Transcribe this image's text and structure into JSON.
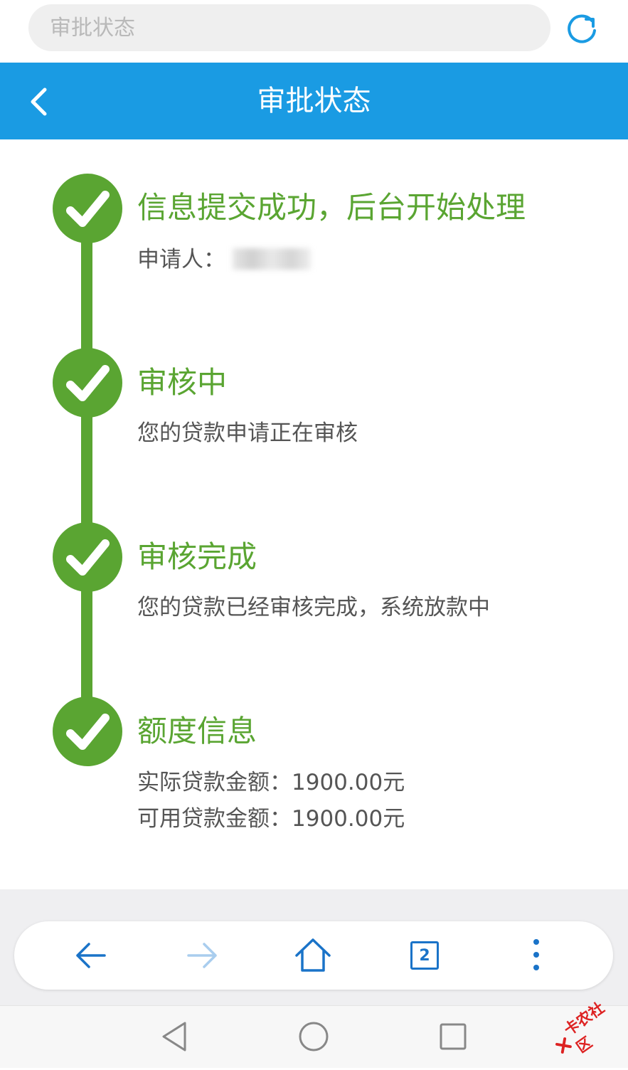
{
  "address_bar": {
    "placeholder": "审批状态"
  },
  "header": {
    "title": "审批状态"
  },
  "steps": [
    {
      "title": "信息提交成功，后台开始处理",
      "desc": "申请人："
    },
    {
      "title": "审核中",
      "desc": "您的贷款申请正在审核"
    },
    {
      "title": "审核完成",
      "desc": "您的贷款已经审核完成，系统放款中"
    },
    {
      "title": "额度信息",
      "desc": "实际贷款金额：1900.00元",
      "desc2": "可用贷款金额：1900.00元"
    }
  ],
  "browser_nav": {
    "tab_count": "2"
  },
  "watermark": {
    "text": "卡农社区"
  },
  "colors": {
    "primary": "#1a9be3",
    "success": "#5aa532",
    "text": "#555555",
    "nav_icon": "#1a73c8",
    "nav_icon_disabled": "#a9cdee"
  }
}
